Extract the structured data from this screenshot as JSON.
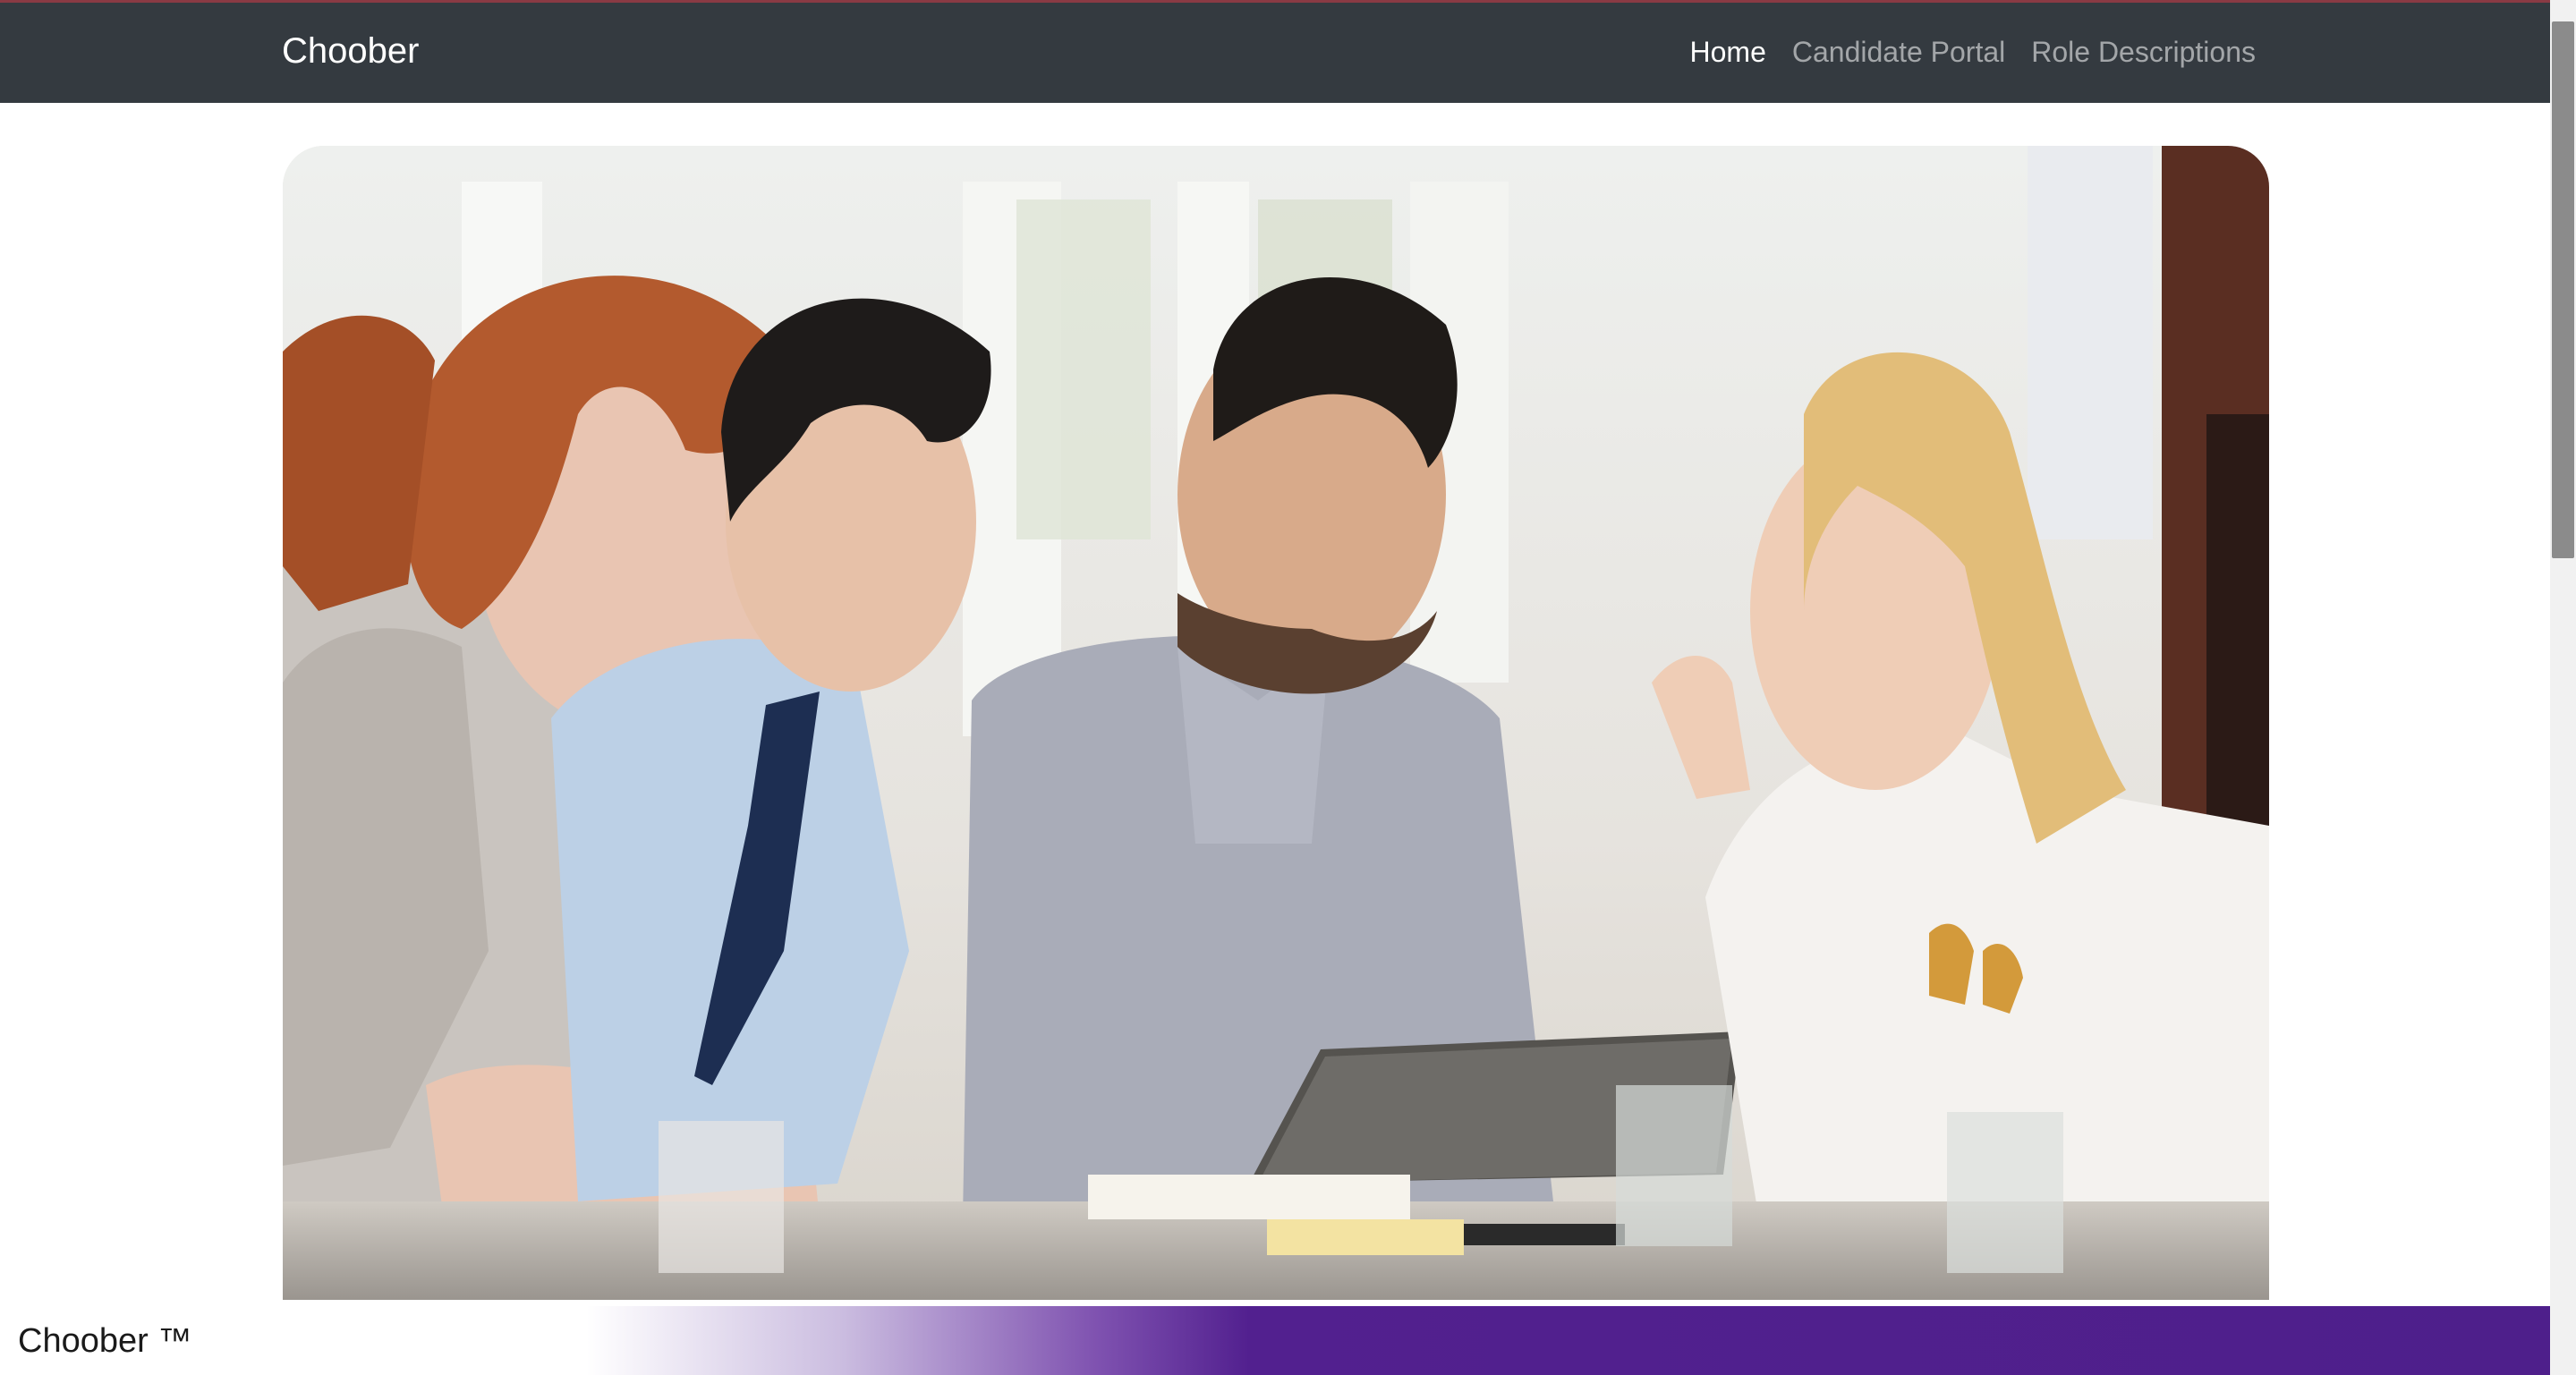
{
  "navbar": {
    "brand": "Choober",
    "links": [
      {
        "label": "Home",
        "active": true
      },
      {
        "label": "Candidate Portal",
        "active": false
      },
      {
        "label": "Role Descriptions",
        "active": false
      }
    ]
  },
  "hero": {
    "image_icon": "team-meeting-photo"
  },
  "footer": {
    "text": "Choober ™"
  },
  "colors": {
    "navbar_bg": "#343a40",
    "footer_accent": "#4e1f8b"
  }
}
